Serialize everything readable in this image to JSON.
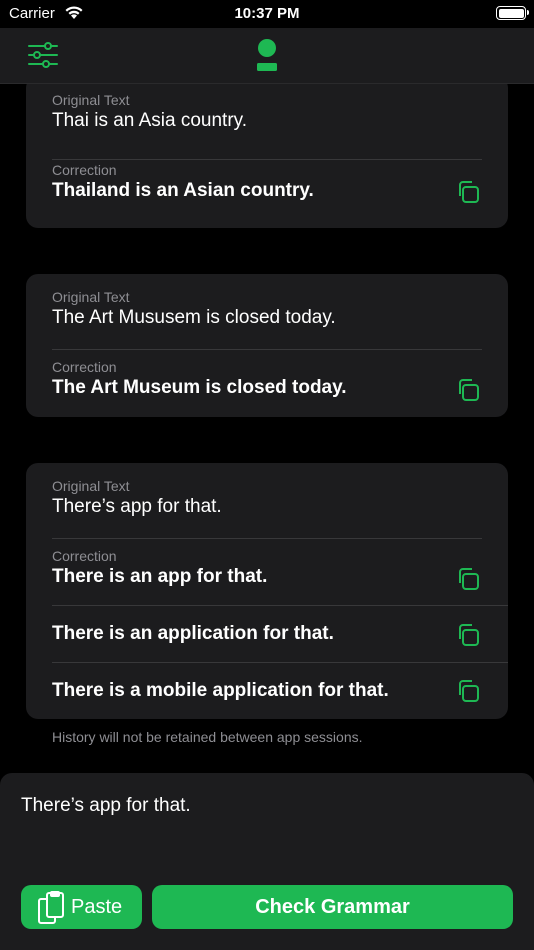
{
  "status_bar": {
    "carrier": "Carrier",
    "time": "10:37 PM"
  },
  "nav": {
    "settings_icon": "sliders-icon",
    "logo_icon": "app-logo-icon"
  },
  "colors": {
    "accent": "#1eb853",
    "card_bg": "#1c1c1e",
    "secondary_text": "#8e8e93"
  },
  "history": {
    "original_label": "Original Text",
    "correction_label": "Correction",
    "cards": [
      {
        "original": "Thai is an Asia country.",
        "corrections": [
          "Thailand is an Asian country."
        ]
      },
      {
        "original": "The Art Mususem is closed today.",
        "corrections": [
          "The Art Museum is closed today."
        ]
      },
      {
        "original": "There’s app for that.",
        "corrections": [
          "There is an app for that.",
          "There is an application for that.",
          "There is a mobile application for that."
        ]
      }
    ],
    "footnote": "History will not be retained between app sessions."
  },
  "input": {
    "value": "There’s app for that."
  },
  "buttons": {
    "paste": "Paste",
    "check": "Check Grammar"
  }
}
